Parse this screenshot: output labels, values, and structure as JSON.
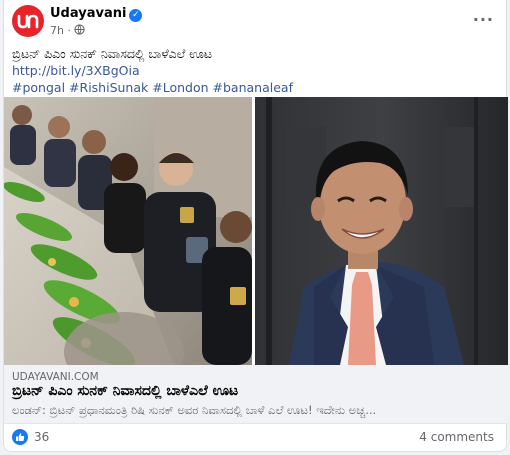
{
  "post": {
    "page_name": "Udayavani",
    "time": "7h",
    "dot": "·",
    "more_label": "···",
    "text_title": "ಬ್ರಿಟನ್ ಪಿಎಂ ಸುನಕ್ ನಿವಾಸದಲ್ಲಿ ಬಾಳೆಎಲೆ ಊಟ",
    "link": "http://bit.ly/3XBgOia",
    "hashtags": [
      "#pongal",
      "#RishiSunak",
      "#London",
      "#bananaleaf"
    ]
  },
  "preview": {
    "domain": "UDAYAVANI.COM",
    "title": "ಬ್ರಿಟನ್ ಪಿಎಂ ಸುನಕ್ ನಿವಾಸದಲ್ಲಿ ಬಾಳೆಎಲೆ ಊಟ",
    "description": "ಲಂಡನ್: ಬ್ರಿಟನ್ ಪ್ರಧಾನಮಂತ್ರಿ ರಿಷಿ ಸುನಕ್ ಅವರ ನಿವಾಸದಲ್ಲಿ ಬಾಳೆ ಎಲೆ ಊಟ! ಇದೇನು ಅಚ್ಚ..."
  },
  "footer": {
    "like_count": "36",
    "comments": "4 comments"
  },
  "colors": {
    "brand_red": "#e8232a",
    "facebook_blue": "#1877f2",
    "link_blue": "#385898",
    "muted_gray": "#65676b"
  }
}
